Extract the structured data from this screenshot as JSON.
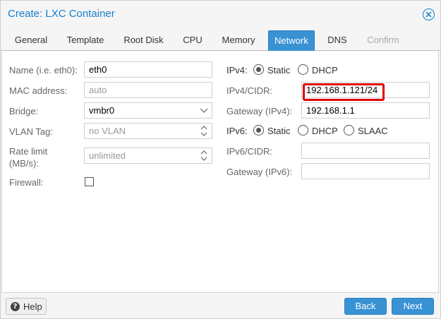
{
  "window": {
    "title": "Create: LXC Container"
  },
  "tabs": [
    {
      "label": "General"
    },
    {
      "label": "Template"
    },
    {
      "label": "Root Disk"
    },
    {
      "label": "CPU"
    },
    {
      "label": "Memory"
    },
    {
      "label": "Network"
    },
    {
      "label": "DNS"
    },
    {
      "label": "Confirm"
    }
  ],
  "active_tab": "Network",
  "left": {
    "name": {
      "label": "Name (i.e. eth0):",
      "value": "eth0"
    },
    "mac": {
      "label": "MAC address:",
      "placeholder": "auto"
    },
    "bridge": {
      "label": "Bridge:",
      "value": "vmbr0"
    },
    "vlan": {
      "label": "VLAN Tag:",
      "placeholder": "no VLAN"
    },
    "rate": {
      "label_line1": "Rate limit",
      "label_line2": "(MB/s):",
      "placeholder": "unlimited"
    },
    "firewall": {
      "label": "Firewall:",
      "checked": false
    }
  },
  "right": {
    "ipv4": {
      "label": "IPv4:",
      "options": [
        "Static",
        "DHCP"
      ],
      "selected": "Static"
    },
    "ipv4_cidr": {
      "label": "IPv4/CIDR:",
      "value": "192.168.1.121/24"
    },
    "gateway4": {
      "label": "Gateway (IPv4):",
      "value": "192.168.1.1"
    },
    "ipv6": {
      "label": "IPv6:",
      "options": [
        "Static",
        "DHCP",
        "SLAAC"
      ],
      "selected": "Static"
    },
    "ipv6_cidr": {
      "label": "IPv6/CIDR:",
      "value": ""
    },
    "gateway6": {
      "label": "Gateway (IPv6):",
      "value": ""
    }
  },
  "footer": {
    "help": "Help",
    "back": "Back",
    "next": "Next"
  },
  "colors": {
    "accent": "#3892d4",
    "title": "#157fcc",
    "highlight": "#e00000"
  }
}
